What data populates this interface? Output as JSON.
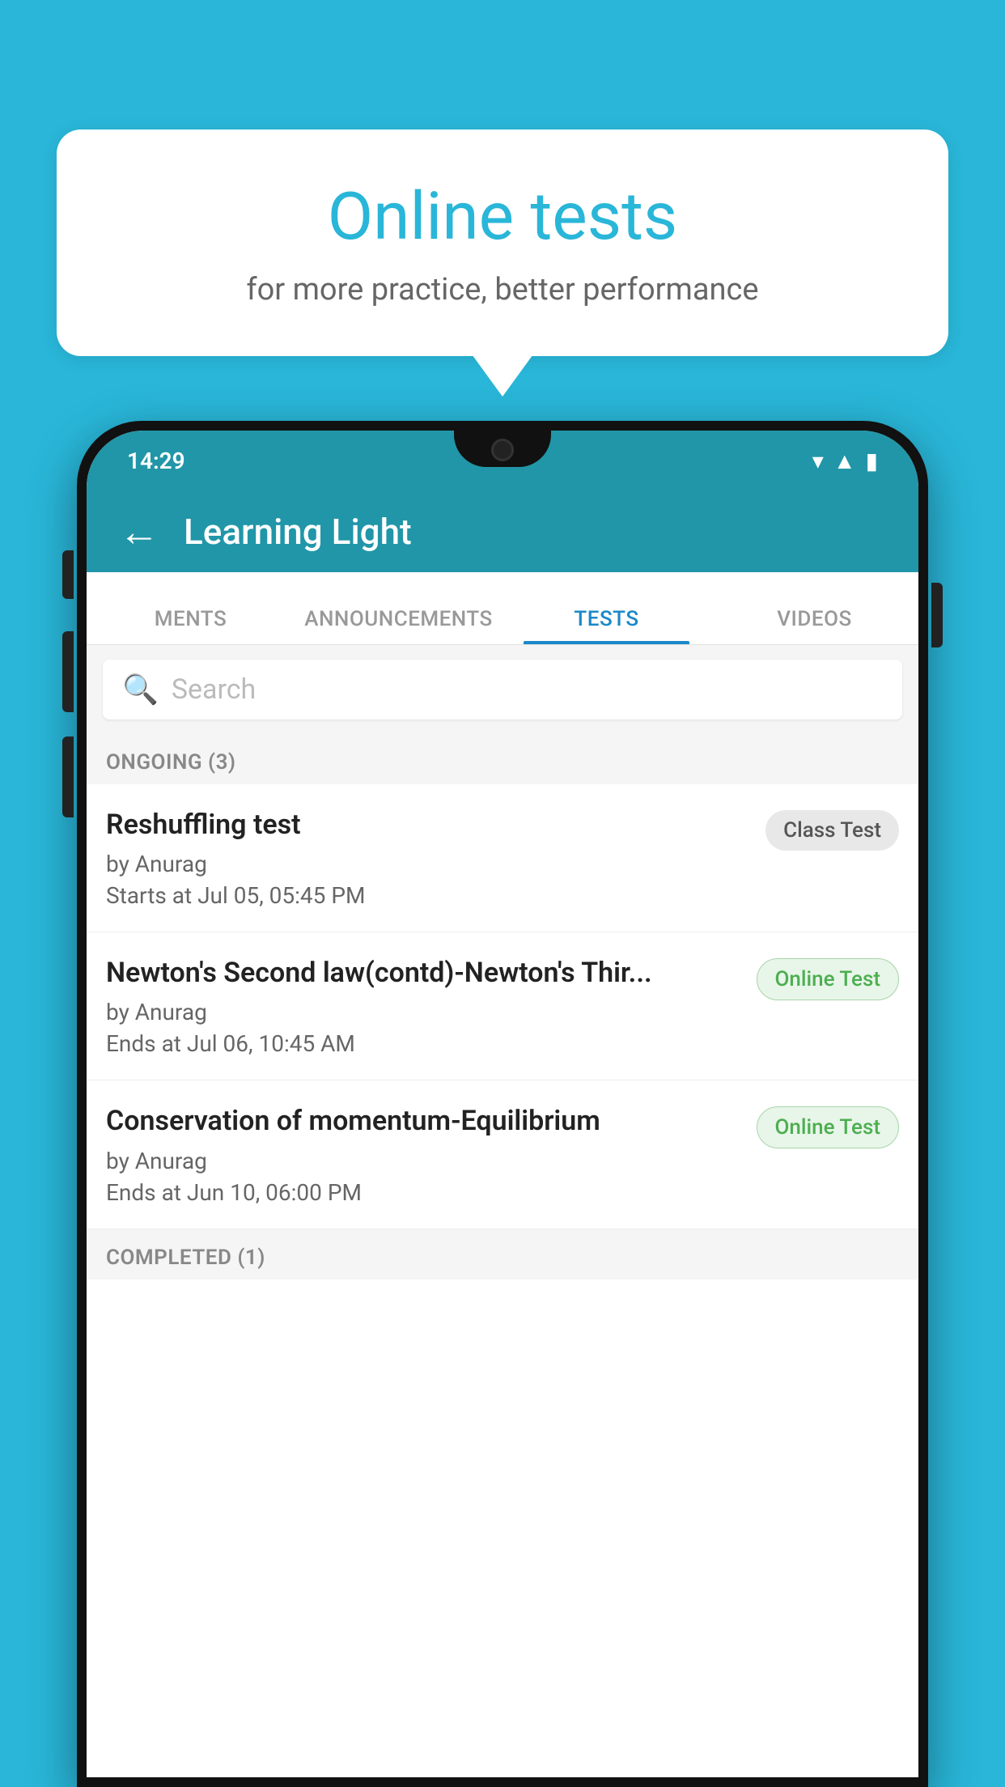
{
  "background_color": "#29b6d8",
  "speech_bubble": {
    "title": "Online tests",
    "subtitle": "for more practice, better performance"
  },
  "phone": {
    "status_bar": {
      "time": "14:29",
      "icons": [
        "wifi",
        "signal",
        "battery"
      ]
    },
    "header": {
      "title": "Learning Light",
      "back_label": "←"
    },
    "tabs": [
      {
        "label": "MENTS",
        "active": false
      },
      {
        "label": "ANNOUNCEMENTS",
        "active": false
      },
      {
        "label": "TESTS",
        "active": true
      },
      {
        "label": "VIDEOS",
        "active": false
      }
    ],
    "search": {
      "placeholder": "Search"
    },
    "ongoing_section": {
      "label": "ONGOING (3)"
    },
    "test_items": [
      {
        "title": "Reshuffling test",
        "author": "by Anurag",
        "time_label": "Starts at",
        "time": "Jul 05, 05:45 PM",
        "badge": "Class Test",
        "badge_type": "class"
      },
      {
        "title": "Newton's Second law(contd)-Newton's Thir...",
        "author": "by Anurag",
        "time_label": "Ends at",
        "time": "Jul 06, 10:45 AM",
        "badge": "Online Test",
        "badge_type": "online"
      },
      {
        "title": "Conservation of momentum-Equilibrium",
        "author": "by Anurag",
        "time_label": "Ends at",
        "time": "Jun 10, 06:00 PM",
        "badge": "Online Test",
        "badge_type": "online"
      }
    ],
    "completed_section": {
      "label": "COMPLETED (1)"
    }
  }
}
